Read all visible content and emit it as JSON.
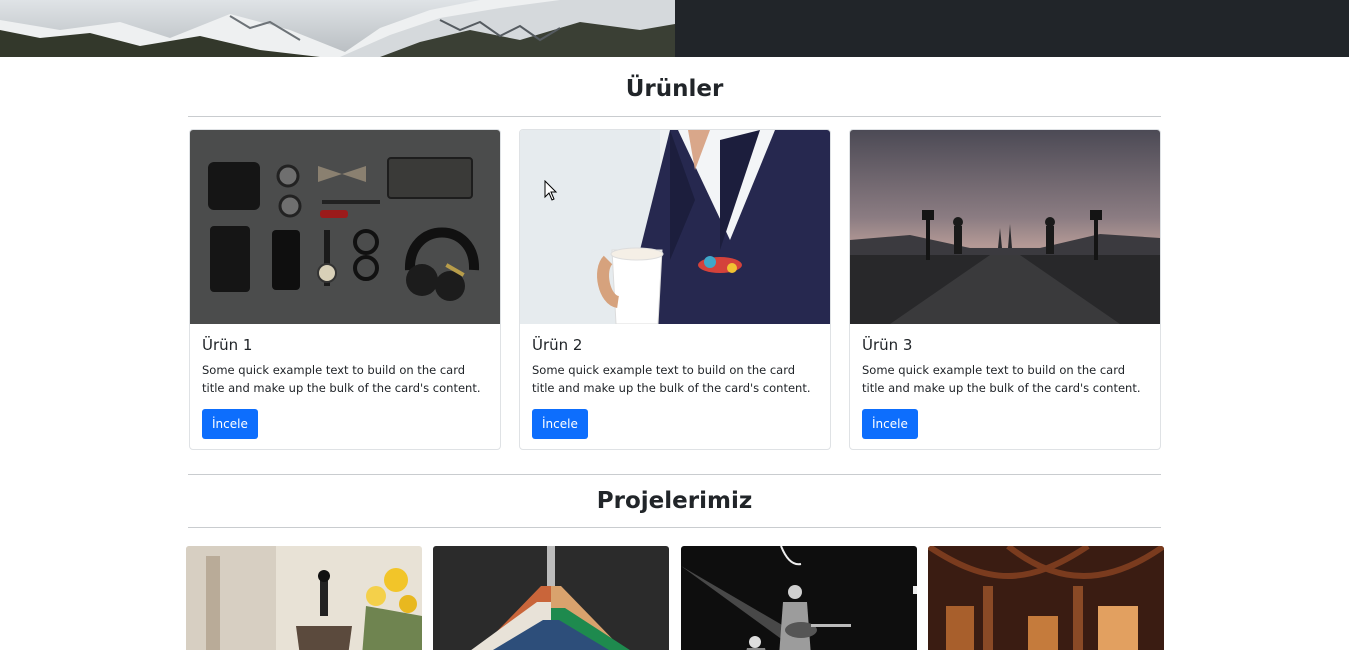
{
  "products": {
    "heading": "Ürünler",
    "cards": [
      {
        "title": "Ürün 1",
        "text": "Some quick example text to build on the card title and make up the bulk of the card's content.",
        "button": "İncele",
        "image": "flat-lay-accessories-photo"
      },
      {
        "title": "Ürün 2",
        "text": "Some quick example text to build on the card title and make up the bulk of the card's content.",
        "button": "İncele",
        "image": "man-in-suit-with-coffee-photo"
      },
      {
        "title": "Ürün 3",
        "text": "Some quick example text to build on the card title and make up the bulk of the card's content.",
        "button": "İncele",
        "image": "foggy-bridge-statues-photo"
      }
    ]
  },
  "projects": {
    "heading": "Projelerimiz",
    "tiles": [
      {
        "image": "coffee-press-flowers-photo"
      },
      {
        "image": "clothes-hangers-photo"
      },
      {
        "image": "concert-guitarist-photo"
      },
      {
        "image": "arched-corridor-photo"
      }
    ]
  },
  "colors": {
    "primary": "#0d6efd",
    "dark": "#212529"
  }
}
